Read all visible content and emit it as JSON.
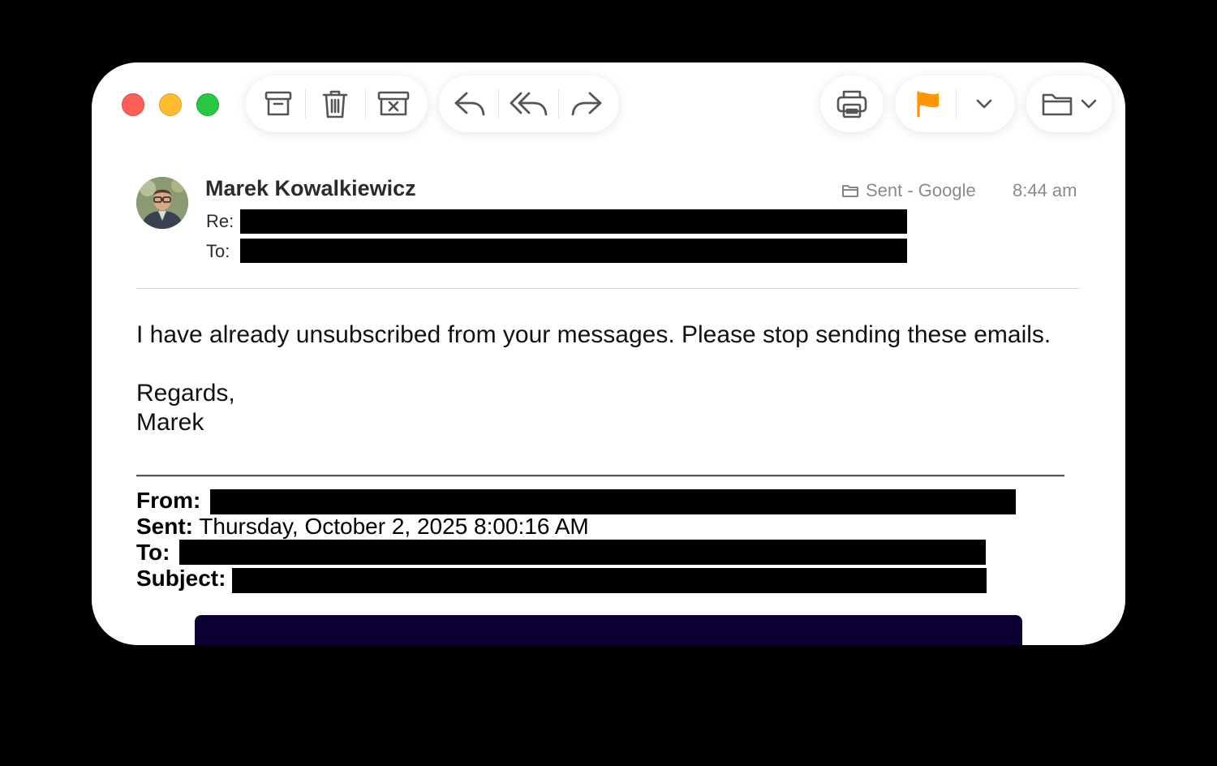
{
  "window": {
    "controls": [
      "close",
      "minimize",
      "zoom"
    ]
  },
  "toolbar": {
    "groups": [
      {
        "name": "mailbox-actions",
        "buttons": [
          "archive-icon",
          "trash-icon",
          "junk-icon"
        ]
      },
      {
        "name": "reply-actions",
        "buttons": [
          "reply-icon",
          "reply-all-icon",
          "forward-icon"
        ]
      },
      {
        "name": "print",
        "buttons": [
          "print-icon"
        ]
      },
      {
        "name": "flag",
        "buttons": [
          "flag-icon",
          "chevron-down-icon"
        ],
        "flag_color": "#ff9500"
      },
      {
        "name": "move",
        "buttons": [
          "folder-icon",
          "chevron-down-icon"
        ]
      }
    ]
  },
  "message": {
    "sender": "Marek Kowalkiewicz",
    "mailbox": "Sent - Google",
    "time": "8:44 am",
    "re_label": "Re:",
    "to_label": "To:",
    "body_line1": "I have already unsubscribed from your messages. Please stop sending these emails.",
    "signoff": "Regards,",
    "signature": "Marek"
  },
  "forwarded": {
    "from_label": "From:",
    "sent_label": "Sent:",
    "sent_value": "Thursday, October 2, 2025 8:00:16 AM",
    "to_label": "To:",
    "subject_label": "Subject:"
  },
  "colors": {
    "banner": "#0c0033",
    "accent_flag": "#ff9500",
    "close": "#fe5f57",
    "minimize": "#febc2e",
    "zoom": "#28c840"
  }
}
